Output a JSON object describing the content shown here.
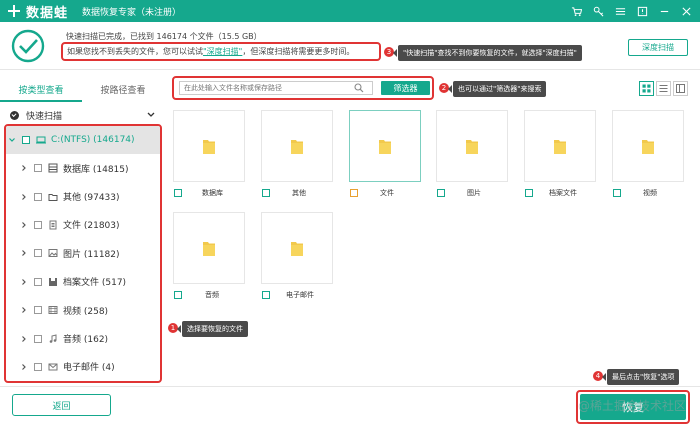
{
  "app": {
    "title": "数据蛙",
    "subtitle": "数据恢复专家（未注册）"
  },
  "status": {
    "line1": "快速扫描已完成，已找到 146174 个文件（15.5 GB）",
    "hint_pre": "如果您找不到丢失的文件，您可以试试",
    "hint_link": "\"深度扫描\"",
    "hint_post": "，但深度扫描将需要更多时间。",
    "deep_scan_label": "深度扫描"
  },
  "tips": {
    "t3": {
      "num": "3",
      "text": "\"快速扫描\"查找不到你要恢复的文件，就选择\"深度扫描\""
    },
    "t2": {
      "num": "2",
      "text": "也可以通过\"筛选器\"来搜索"
    },
    "t1": {
      "num": "1",
      "text": "选择要恢复的文件"
    },
    "t4": {
      "num": "4",
      "text": "最后点击\"恢复\"选项"
    }
  },
  "left_tabs": [
    {
      "label": "按类型查看",
      "active": true
    },
    {
      "label": "按路径查看",
      "active": false
    }
  ],
  "quick_scan_label": "快速扫描",
  "tree": {
    "root": "C:(NTFS) (146174)",
    "items": [
      {
        "label": "数据库 (14815)",
        "icon": "database-icon"
      },
      {
        "label": "其他 (97433)",
        "icon": "folder-icon"
      },
      {
        "label": "文件 (21803)",
        "icon": "document-icon"
      },
      {
        "label": "图片 (11182)",
        "icon": "image-icon"
      },
      {
        "label": "档案文件 (517)",
        "icon": "archive-icon"
      },
      {
        "label": "视频 (258)",
        "icon": "video-icon"
      },
      {
        "label": "音频 (162)",
        "icon": "audio-icon"
      },
      {
        "label": "电子邮件 (4)",
        "icon": "email-icon"
      }
    ]
  },
  "search": {
    "placeholder": "在此处输入文件名称或保存路径"
  },
  "filter_label": "筛选器",
  "grid": [
    {
      "label": "数据库",
      "selected": false,
      "cb": "green"
    },
    {
      "label": "其他",
      "selected": false,
      "cb": "green"
    },
    {
      "label": "文件",
      "selected": true,
      "cb": "orange"
    },
    {
      "label": "图片",
      "selected": false,
      "cb": "green"
    },
    {
      "label": "档案文件",
      "selected": false,
      "cb": "green"
    },
    {
      "label": "视频",
      "selected": false,
      "cb": "green"
    },
    {
      "label": "音频",
      "selected": false,
      "cb": "green"
    },
    {
      "label": "电子邮件",
      "selected": false,
      "cb": "green"
    }
  ],
  "back_label": "返回",
  "recover_label": "恢复",
  "watermark": "@稀土掘金技术社区",
  "colors": {
    "accent": "#15a88d",
    "annotation": "#e03434",
    "folder": "#f2c94c"
  }
}
